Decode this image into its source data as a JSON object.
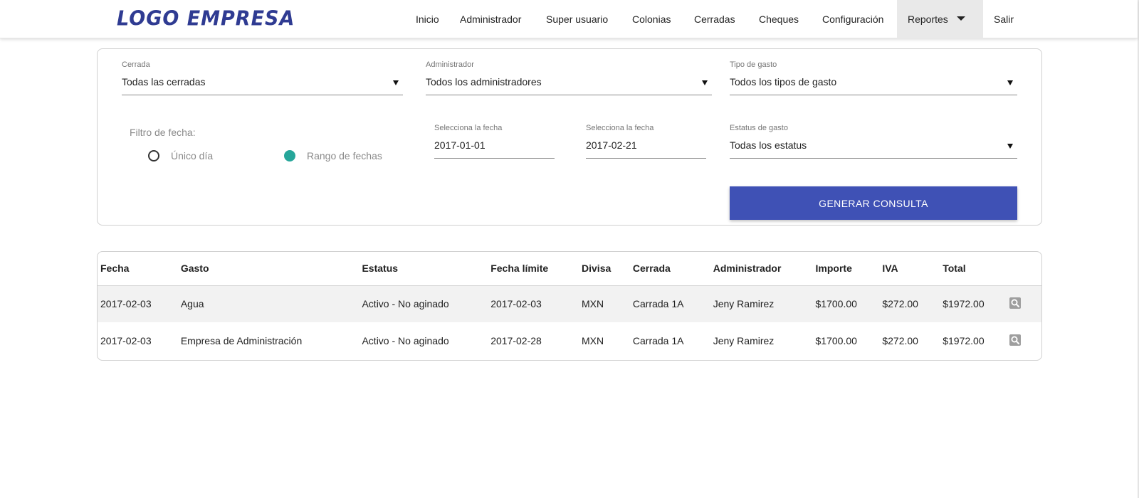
{
  "header": {
    "logo_text": "LOGO EMPRESA",
    "nav": [
      {
        "label": "Inicio"
      },
      {
        "label": "Administrador"
      },
      {
        "label": "Super usuario"
      },
      {
        "label": "Colonias"
      },
      {
        "label": "Cerradas"
      },
      {
        "label": "Cheques"
      },
      {
        "label": "Configuración"
      },
      {
        "label": "Reportes",
        "active": true
      },
      {
        "label": "Salir"
      }
    ]
  },
  "filters": {
    "cerrada": {
      "label": "Cerrada",
      "value": "Todas las cerradas"
    },
    "administrador": {
      "label": "Administrador",
      "value": "Todos los administradores"
    },
    "tipo_gasto": {
      "label": "Tipo de gasto",
      "value": "Todos los tipos de gasto"
    },
    "filtro_fecha": {
      "label": "Filtro de fecha:",
      "options": [
        {
          "label": "Único día",
          "selected": false
        },
        {
          "label": "Rango de fechas",
          "selected": true
        }
      ]
    },
    "fecha_inicio": {
      "label": "Selecciona la fecha",
      "value": "2017-01-01"
    },
    "fecha_fin": {
      "label": "Selecciona la fecha",
      "value": "2017-02-21"
    },
    "estatus": {
      "label": "Estatus de gasto",
      "value": "Todas los estatus"
    },
    "generate_label": "GENERAR CONSULTA"
  },
  "table": {
    "columns": [
      "Fecha",
      "Gasto",
      "Estatus",
      "Fecha límite",
      "Divisa",
      "Cerrada",
      "Administrador",
      "Importe",
      "IVA",
      "Total"
    ],
    "rows": [
      [
        "2017-02-03",
        "Agua",
        "Activo - No aginado",
        "2017-02-03",
        "MXN",
        "Carrada 1A",
        "Jeny Ramirez",
        "$1700.00",
        "$272.00",
        "$1972.00"
      ],
      [
        "2017-02-03",
        "Empresa de Administración",
        "Activo - No aginado",
        "2017-02-28",
        "MXN",
        "Carrada 1A",
        "Jeny Ramirez",
        "$1700.00",
        "$272.00",
        "$1972.00"
      ]
    ],
    "row_action_icon": "search-document-icon"
  },
  "colors": {
    "brand": "#2f3b92",
    "primary_button": "#3f51b5",
    "radio_selected": "#26a69a",
    "active_nav_bg": "#e9e9e9"
  }
}
